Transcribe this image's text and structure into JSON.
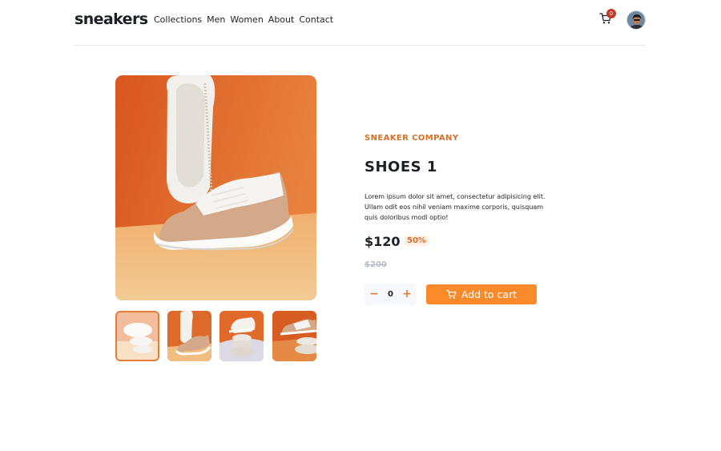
{
  "header": {
    "logo": "sneakers",
    "nav": [
      "Collections",
      "Men",
      "Women",
      "About",
      "Contact"
    ],
    "cart_count": "0",
    "icons": {
      "cart": "cart-icon",
      "avatar": "avatar"
    }
  },
  "product": {
    "company": "SNEAKER COMPANY",
    "title": "SHOES 1",
    "description": "Lorem ipsum dolor sit amet, consectetur adipisicing elit. Ullam odit eos nihil veniam maxime corporis, quisquam quis doloribus modi optio!",
    "price": "$120",
    "discount": "50%",
    "old_price": "$200",
    "quantity": "0",
    "add_to_cart": "Add to cart",
    "selected_thumbnail": 1
  },
  "colors": {
    "accent": "#fb8a2b",
    "accent_text": "#d5702a",
    "discount_bg": "#ffeee2",
    "badge": "#c23b2a",
    "dark": "#1d2026",
    "muted": "#b6bcc8"
  }
}
